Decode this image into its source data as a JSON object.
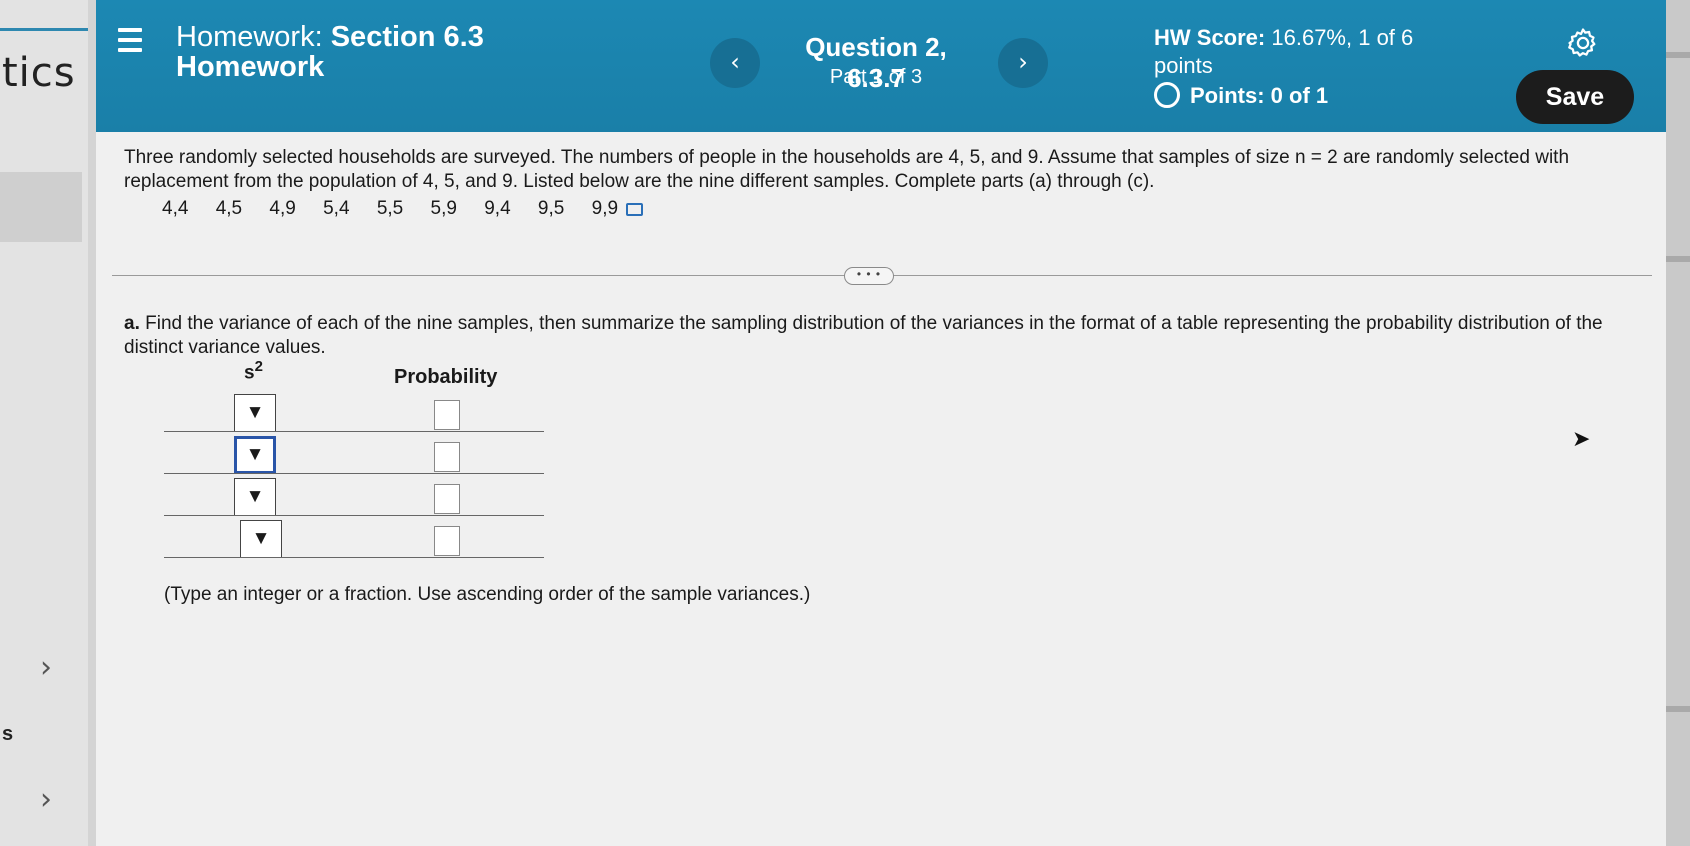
{
  "sidebar": {
    "partial_title": "tics",
    "partial_letter": "s",
    "chevron": "›"
  },
  "header": {
    "menu_icon": "hamburger-menu-icon",
    "homework_prefix": "Homework:",
    "homework_section": "Section 6.3",
    "homework_line2": "Homework",
    "prev_label": "‹",
    "next_label": "›",
    "question_title": "Question 2, 6.3.7",
    "question_part": "Part 1 of 3",
    "score_label": "HW Score:",
    "score_value": "16.67%, 1 of 6",
    "score_unit": "points",
    "points_text": "Points: 0 of 1",
    "settings_icon": "gear-icon",
    "save_label": "Save",
    "brand_color": "#1c88b3"
  },
  "question": {
    "intro": "Three randomly selected households are surveyed. The numbers of people in the households are 4, 5, and 9. Assume that samples of size n = 2 are randomly selected with replacement from the population of 4, 5, and 9. Listed below are the nine different samples. Complete parts (a) through (c).",
    "samples": [
      "4,4",
      "4,5",
      "4,9",
      "5,4",
      "5,5",
      "5,9",
      "9,4",
      "9,5",
      "9,9"
    ],
    "more_label": "• • •"
  },
  "part_a": {
    "label": "a.",
    "text": "Find the variance of each of the nine samples, then summarize the sampling distribution of the variances in the format of a table representing the probability distribution of the distinct variance values.",
    "col_s": "s",
    "col_s_sup": "2",
    "col_prob": "Probability",
    "dropdown_arrow": "▼",
    "rows": [
      {
        "s2": "",
        "prob": ""
      },
      {
        "s2": "",
        "prob": ""
      },
      {
        "s2": "",
        "prob": ""
      },
      {
        "s2": "",
        "prob": ""
      }
    ],
    "hint": "(Type an integer or a fraction. Use ascending order of the sample variances.)"
  }
}
